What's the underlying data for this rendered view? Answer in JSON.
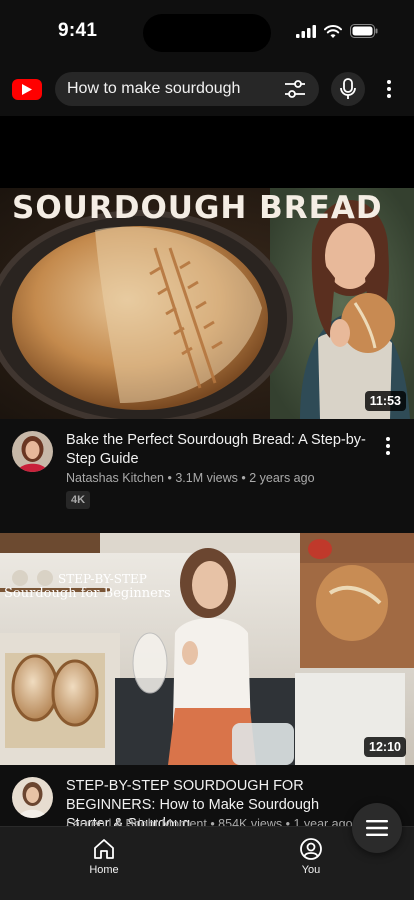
{
  "status": {
    "time": "9:41"
  },
  "search": {
    "query": "How to make sourdough"
  },
  "videos": [
    {
      "thumb_title": "SOURDOUGH BREAD",
      "duration": "11:53",
      "title": "Bake the Perfect Sourdough Bread: A Step-by-Step Guide",
      "channel": "Natashas Kitchen",
      "views": "3.1M views",
      "age": "2 years ago",
      "badge": "4K"
    },
    {
      "thumb_line1": "STEP-BY-STEP",
      "thumb_line2": "Sourdough for Beginners",
      "duration": "12:10",
      "title": "STEP-BY-STEP SOURDOUGH FOR BEGINNERS: How to Make Sourdough Starter & Sourdoug...",
      "channel": "Lauren | A Bright Moment",
      "views": "854K views",
      "age": "1 year ago"
    }
  ],
  "nav": {
    "home_label": "Home",
    "you_label": "You"
  },
  "colors": {
    "brand": "#ff0000",
    "background": "#0f0f0f",
    "surface": "#272727"
  }
}
